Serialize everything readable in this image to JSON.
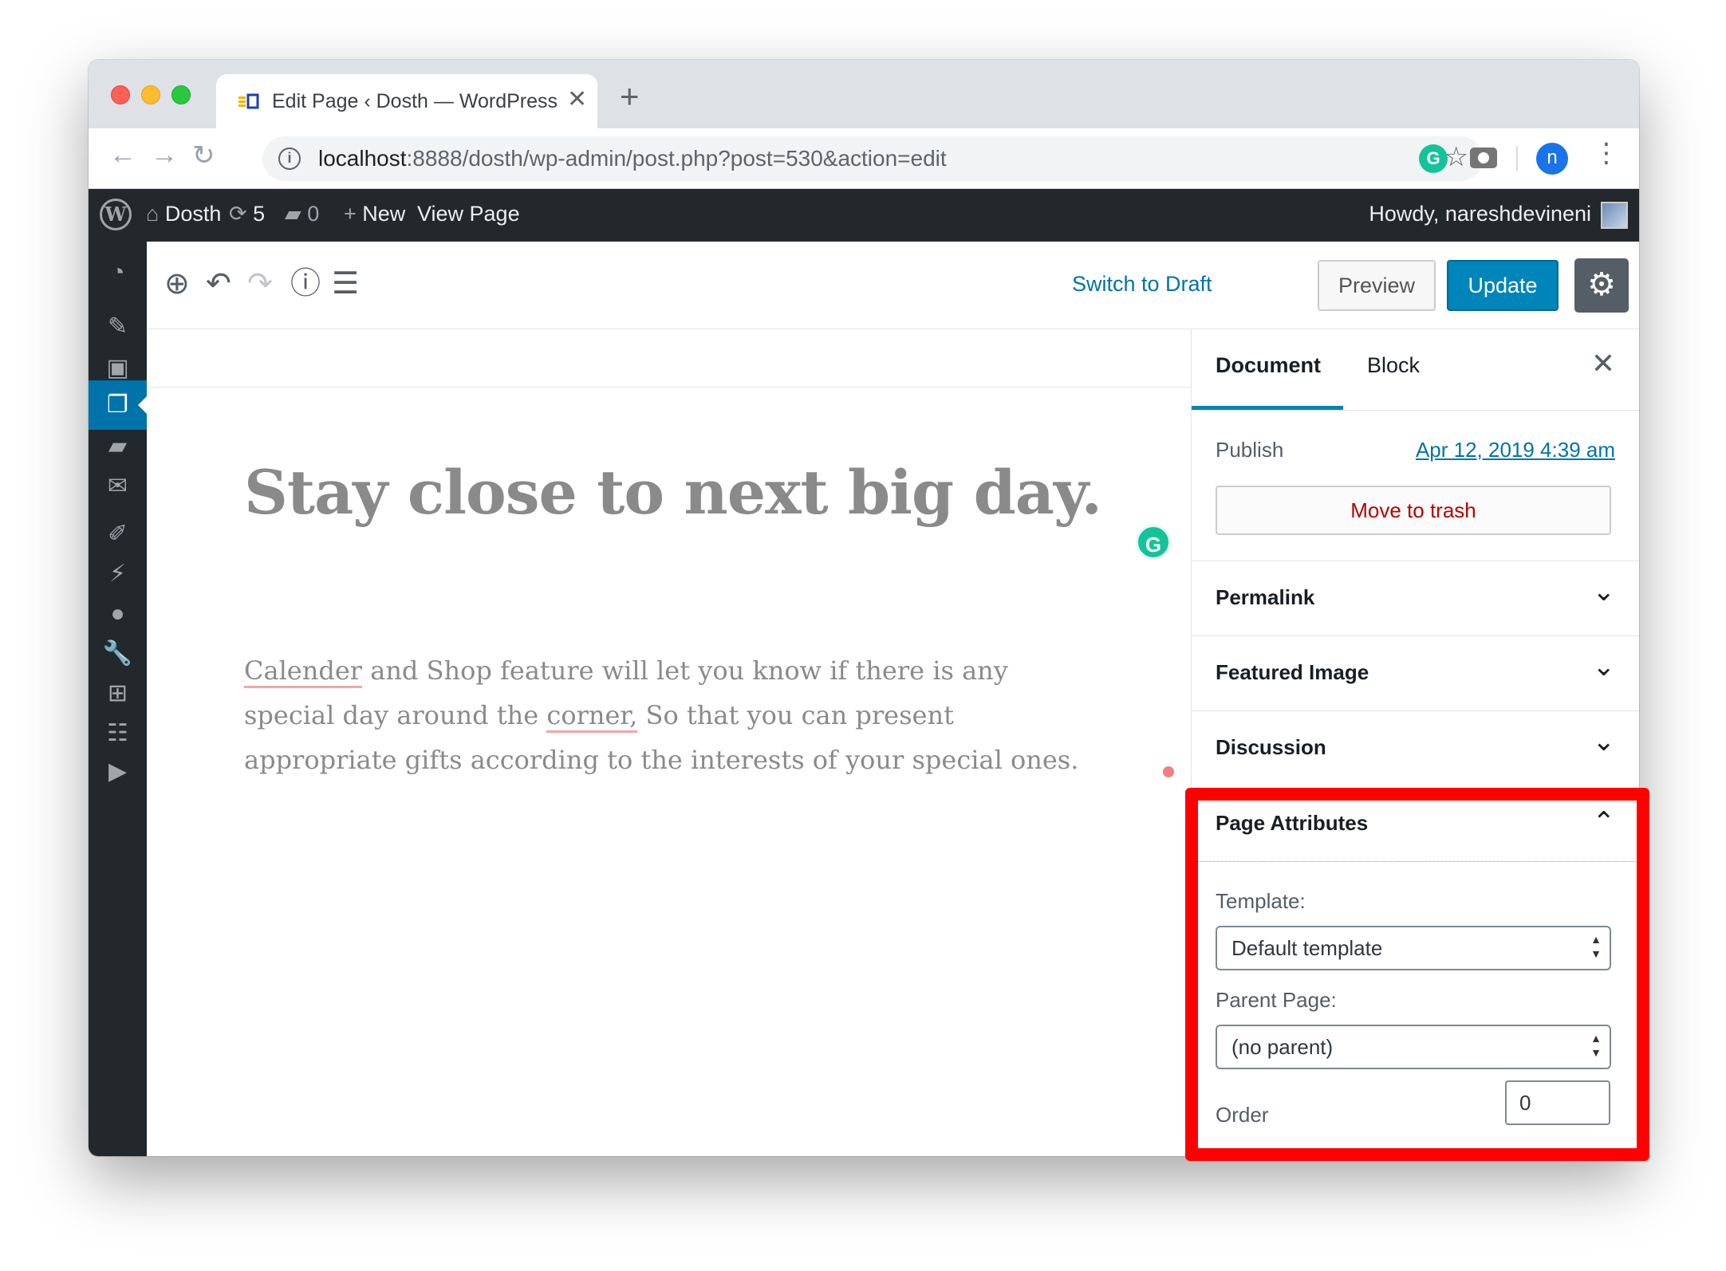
{
  "browser": {
    "tab_title": "Edit Page ‹ Dosth — WordPress",
    "url_host": "localhost",
    "url_path": ":8888/dosth/wp-admin/post.php?post=530&action=edit",
    "profile_initial": "n",
    "grammarly_letter": "G"
  },
  "adminbar": {
    "site_name": "Dosth",
    "updates_count": "5",
    "comments_count": "0",
    "new_label": "New",
    "view_page_label": "View Page",
    "howdy": "Howdy, nareshdevineni"
  },
  "editor": {
    "switch_to_draft": "Switch to Draft",
    "preview": "Preview",
    "update": "Update"
  },
  "post": {
    "title": "Stay close to next big day.",
    "body_underlined_1": "Calender",
    "body_part_1": " and Shop feature will let you know if there is any special day around the ",
    "body_underlined_2": "corner,",
    "body_part_2": " So that you can present appropriate gifts according to the interests of your special ones."
  },
  "sidebar": {
    "tab_document": "Document",
    "tab_block": "Block",
    "publish_label": "Publish",
    "publish_date": "Apr 12, 2019 4:39 am",
    "move_to_trash": "Move to trash",
    "panels": {
      "permalink": "Permalink",
      "featured_image": "Featured Image",
      "discussion": "Discussion",
      "page_attributes": "Page Attributes"
    },
    "template_label": "Template:",
    "template_value": "Default template",
    "parent_label": "Parent Page:",
    "parent_value": "(no parent)",
    "order_label": "Order",
    "order_value": "0"
  },
  "colors": {
    "wp_dark": "#23282d",
    "wp_blue": "#0085ba",
    "highlight": "#ff0000",
    "trash_red": "#bb0000"
  }
}
